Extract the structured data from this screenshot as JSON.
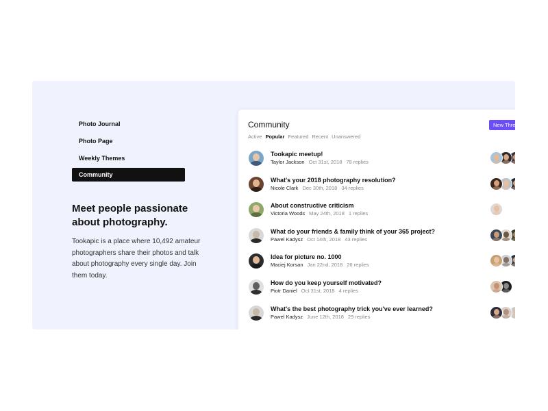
{
  "nav": {
    "items": [
      {
        "label": "Photo Journal",
        "active": false
      },
      {
        "label": "Photo Page",
        "active": false
      },
      {
        "label": "Weekly Themes",
        "active": false
      },
      {
        "label": "Community",
        "active": true
      }
    ]
  },
  "hero": {
    "title": "Meet people passionate about photography.",
    "text": "Tookapic is a place where 10,492 amateur photographers share their photos and talk about photography every single day. Join them today."
  },
  "community": {
    "title": "Community",
    "new_thread_label": "New Thread",
    "tabs": [
      {
        "label": "Active",
        "active": false
      },
      {
        "label": "Popular",
        "active": true
      },
      {
        "label": "Featured",
        "active": false
      },
      {
        "label": "Recent",
        "active": false
      },
      {
        "label": "Unanswered",
        "active": false
      }
    ],
    "threads": [
      {
        "title": "Tookapic meetup!",
        "author": "Taylor Jackson",
        "date": "Oct 31st, 2018",
        "replies": "78 replies",
        "avatar": {
          "bg": "#7aa6c7",
          "skin": "#e8c4a8",
          "shirt": "#3d5a78"
        },
        "participants": [
          {
            "bg": "#a8c4d8",
            "skin": "#e5b996"
          },
          {
            "bg": "#2a2a2a",
            "skin": "#d9a886"
          },
          {
            "bg": "#3a3040",
            "skin": "#caa07f"
          },
          {
            "bg": "#e8d6c8",
            "skin": "#c08060"
          }
        ]
      },
      {
        "title": "What's your 2018 photography resolution?",
        "author": "Nicole Clark",
        "date": "Dec 30th, 2018",
        "replies": "34 replies",
        "avatar": {
          "bg": "#6b4430",
          "skin": "#e2b38f",
          "shirt": "#2d1e18"
        },
        "participants": [
          {
            "bg": "#3a2820",
            "skin": "#d8a07a"
          },
          {
            "bg": "#b8c4cc",
            "skin": "#e8c0a0"
          },
          {
            "bg": "#1e2a38",
            "skin": "#d0a888"
          },
          {
            "bg": "#506070",
            "skin": "#caa088"
          }
        ]
      },
      {
        "title": "About constructive criticism",
        "author": "Victoria Woods",
        "date": "May 24th, 2018",
        "replies": "1 replies",
        "avatar": {
          "bg": "#8fa868",
          "skin": "#e8c8a8",
          "shirt": "#5a7040"
        },
        "participants": [
          {
            "bg": "#e0d8d4",
            "skin": "#e8bfa0"
          }
        ]
      },
      {
        "title": "What do your friends & family think of your 365 project?",
        "author": "Pawel Kadysz",
        "date": "Oct 14th, 2018",
        "replies": "43 replies",
        "avatar": {
          "bg": "#d8d8d8",
          "skin": "#c8b8a8",
          "shirt": "#2a2a2a"
        },
        "participants": [
          {
            "bg": "#3a4858",
            "skin": "#c89a78"
          },
          {
            "bg": "#e4d8cc",
            "skin": "#6a5848"
          },
          {
            "bg": "#304030",
            "skin": "#a88868"
          },
          {
            "bg": "#486048",
            "skin": "#d8b090"
          }
        ]
      },
      {
        "title": "Idea for picture no. 1000",
        "author": "Maciej Korsan",
        "date": "Jan 22nd, 2018",
        "replies": "26 replies",
        "avatar": {
          "bg": "#2c2c2c",
          "skin": "#e0b898",
          "shirt": "#1a1a1a"
        },
        "participants": [
          {
            "bg": "#c8a078",
            "skin": "#e8c4a0"
          },
          {
            "bg": "#d0d0d0",
            "skin": "#807068"
          },
          {
            "bg": "#283848",
            "skin": "#d8b098"
          },
          {
            "bg": "#5a6a78",
            "skin": "#c8a888"
          }
        ]
      },
      {
        "title": "How do you keep yourself motivated?",
        "author": "Piotr Daniel",
        "date": "Oct 31st, 2018",
        "replies": "4 replies",
        "avatar": {
          "bg": "#e0e0e0",
          "skin": "#606060",
          "shirt": "#303030"
        },
        "participants": [
          {
            "bg": "#d8c4b0",
            "skin": "#c89070"
          },
          {
            "bg": "#1e1e1e",
            "skin": "#8a8a8a"
          }
        ]
      },
      {
        "title": "What's the best photography trick you've ever learned?",
        "author": "Pawel Kadysz",
        "date": "June 12th, 2018",
        "replies": "29 replies",
        "avatar": {
          "bg": "#d8d8d8",
          "skin": "#c8b8a8",
          "shirt": "#2a2a2a"
        },
        "participants": [
          {
            "bg": "#2a2e38",
            "skin": "#d8a888"
          },
          {
            "bg": "#d8d0c8",
            "skin": "#b09080"
          },
          {
            "bg": "#c8ccd0",
            "skin": "#e0c0a0"
          },
          {
            "bg": "#b8c0c8",
            "skin": "#c8a890"
          }
        ]
      }
    ]
  },
  "colors": {
    "accent": "#6b4ef5",
    "stage_bg": "#f0f2fd",
    "nav_active_bg": "#111111"
  }
}
